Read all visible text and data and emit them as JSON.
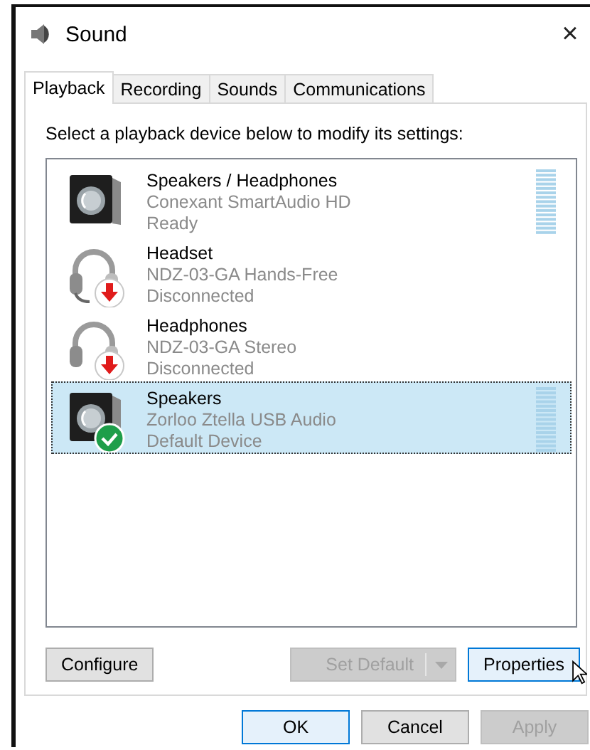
{
  "window": {
    "title": "Sound",
    "close": "×"
  },
  "tabs": [
    {
      "label": "Playback",
      "selected": true
    },
    {
      "label": "Recording",
      "selected": false
    },
    {
      "label": "Sounds",
      "selected": false
    },
    {
      "label": "Communications",
      "selected": false
    }
  ],
  "instruction": "Select a playback device below to modify its settings:",
  "devices": [
    {
      "kind": "speaker",
      "disconnected": false,
      "default_device": false,
      "name": "Speakers / Headphones",
      "driver": "Conexant SmartAudio HD",
      "status": "Ready",
      "meter": true,
      "selected": false
    },
    {
      "kind": "headset",
      "disconnected": true,
      "default_device": false,
      "name": "Headset",
      "driver": "NDZ-03-GA Hands-Free",
      "status": "Disconnected",
      "meter": false,
      "selected": false
    },
    {
      "kind": "headphones",
      "disconnected": true,
      "default_device": false,
      "name": "Headphones",
      "driver": "NDZ-03-GA Stereo",
      "status": "Disconnected",
      "meter": false,
      "selected": false
    },
    {
      "kind": "speaker",
      "disconnected": false,
      "default_device": true,
      "name": "Speakers",
      "driver": "Zorloo Ztella USB Audio",
      "status": "Default Device",
      "meter": true,
      "selected": true
    }
  ],
  "panel_buttons": [
    {
      "kind": "plain",
      "label": "Configure",
      "disabled": false,
      "focused": false
    },
    {
      "kind": "split",
      "label": "Set Default",
      "disabled": true,
      "focused": false
    },
    {
      "kind": "plain",
      "label": "Properties",
      "disabled": false,
      "focused": true
    }
  ],
  "dialog_buttons": [
    {
      "label": "OK",
      "disabled": false,
      "focused": true
    },
    {
      "label": "Cancel",
      "disabled": false,
      "focused": false
    },
    {
      "label": "Apply",
      "disabled": true,
      "focused": false
    }
  ]
}
